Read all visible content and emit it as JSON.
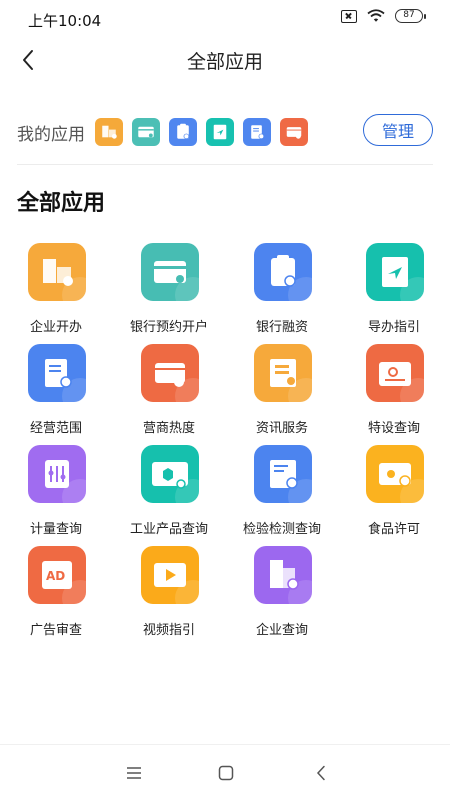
{
  "status_bar": {
    "time": "上午10:04",
    "battery": "87"
  },
  "header": {
    "title": "全部应用",
    "back_icon": "back-arrow-icon"
  },
  "my_apps": {
    "label": "我的应用",
    "manage_label": "管理",
    "icons": [
      {
        "name": "enterprise-icon",
        "color": "#f5a93a"
      },
      {
        "name": "bank-card-icon",
        "color": "#4cbfb5"
      },
      {
        "name": "clipboard-icon",
        "color": "#4f86ef"
      },
      {
        "name": "guide-send-icon",
        "color": "#17c1b0"
      },
      {
        "name": "document-search-icon",
        "color": "#4f86ef"
      },
      {
        "name": "shop-icon",
        "color": "#ef6a45"
      }
    ]
  },
  "all_apps": {
    "title": "全部应用",
    "items": [
      {
        "label": "企业开办",
        "icon": "enterprise-open-icon",
        "color": "#f6a93b"
      },
      {
        "label": "银行预约开户",
        "icon": "bank-account-icon",
        "color": "#47bdb3"
      },
      {
        "label": "银行融资",
        "icon": "bank-finance-icon",
        "color": "#4d84ef"
      },
      {
        "label": "导办指引",
        "icon": "guide-icon",
        "color": "#16c0ad"
      },
      {
        "label": "经营范围",
        "icon": "business-scope-icon",
        "color": "#4c84ef"
      },
      {
        "label": "营商热度",
        "icon": "business-heat-icon",
        "color": "#ee6a43"
      },
      {
        "label": "资讯服务",
        "icon": "news-service-icon",
        "color": "#f6a93b"
      },
      {
        "label": "特设查询",
        "icon": "special-equipment-icon",
        "color": "#ee6a43"
      },
      {
        "label": "计量查询",
        "icon": "metrology-icon",
        "color": "#a06cf0"
      },
      {
        "label": "工业产品查询",
        "icon": "industrial-product-icon",
        "color": "#16c0ad"
      },
      {
        "label": "检验检测查询",
        "icon": "inspection-icon",
        "color": "#4c84ef"
      },
      {
        "label": "食品许可",
        "icon": "food-license-icon",
        "color": "#fbb21f"
      },
      {
        "label": "广告审查",
        "icon": "ad-review-icon",
        "color": "#ef6a43"
      },
      {
        "label": "视频指引",
        "icon": "video-guide-icon",
        "color": "#fbaa1a"
      },
      {
        "label": "企业查询",
        "icon": "enterprise-query-icon",
        "color": "#9c68ef"
      }
    ]
  },
  "nav_bar": {
    "menu_icon": "menu-icon",
    "home_icon": "home-square-icon",
    "back_icon": "nav-back-icon"
  }
}
